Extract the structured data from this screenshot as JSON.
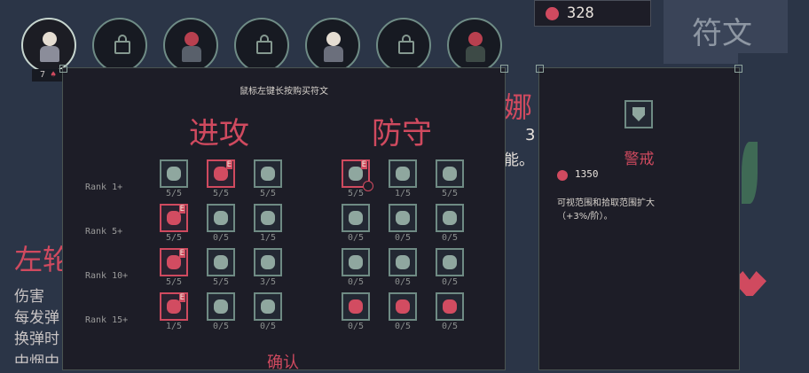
{
  "currency": {
    "amount": "328"
  },
  "tab": {
    "label": "符文"
  },
  "characters": {
    "level_label": "7"
  },
  "panel": {
    "instruction": "鼠标左键长按购买符文",
    "attack_title": "进攻",
    "defense_title": "防守",
    "ranks": [
      "Rank 1+",
      "Rank 5+",
      "Rank 10+",
      "Rank 15+"
    ],
    "confirm": "确认"
  },
  "attack_counts": [
    [
      "5/5",
      "5/5",
      "5/5"
    ],
    [
      "5/5",
      "0/5",
      "1/5"
    ],
    [
      "5/5",
      "5/5",
      "3/5"
    ],
    [
      "1/5",
      "0/5",
      "0/5"
    ]
  ],
  "defense_counts": [
    [
      "5/5",
      "1/5",
      "5/5"
    ],
    [
      "0/5",
      "0/5",
      "0/5"
    ],
    [
      "0/5",
      "0/5",
      "0/5"
    ],
    [
      "0/5",
      "0/5",
      "0/5"
    ]
  ],
  "detail": {
    "title": "警戒",
    "cost": "1350",
    "desc_line1": "可视范围和拾取范围扩大",
    "desc_line2": "（+3%/阶）。"
  },
  "background": {
    "name_fragment": "娜",
    "number_fragment": "3",
    "text_fragment": "能。",
    "hero_fragment": "左轮",
    "stat1": "伤害",
    "stat2": "每发弹",
    "stat3": "换弹时",
    "stat4": "中烟中"
  },
  "colors": {
    "accent": "#d04a5f",
    "panel": "#1d1d27",
    "background": "#2b3547"
  }
}
